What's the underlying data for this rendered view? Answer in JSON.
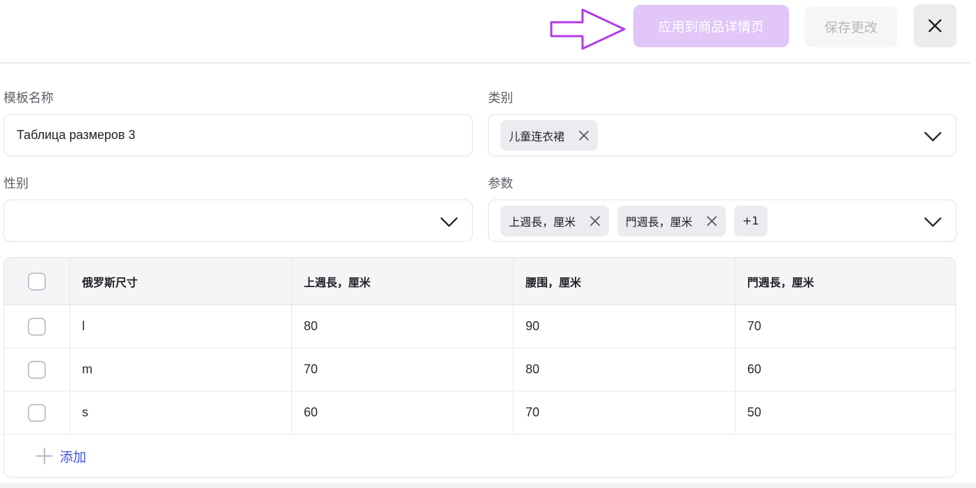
{
  "header": {
    "apply_label": "应用到商品详情页",
    "save_label": "保存更改",
    "close_icon": "close-icon",
    "annotation_icon": "arrow-right-outline-icon",
    "accent_color": "#b13ae6"
  },
  "form": {
    "template_name": {
      "label": "模板名称",
      "value": "Таблица размеров 3"
    },
    "category": {
      "label": "类别",
      "chips": [
        "儿童连衣裙"
      ]
    },
    "gender": {
      "label": "性别",
      "value": ""
    },
    "params": {
      "label": "参数",
      "chips": [
        "上週長，厘米",
        "門週長，厘米"
      ],
      "more": "+1"
    }
  },
  "table": {
    "headers": [
      "俄罗斯尺寸",
      "上週長，厘米",
      "腰围，厘米",
      "門週長，厘米"
    ],
    "rows": [
      [
        "l",
        "80",
        "90",
        "70"
      ],
      [
        "m",
        "70",
        "80",
        "60"
      ],
      [
        "s",
        "60",
        "70",
        "50"
      ]
    ],
    "add_label": "添加"
  }
}
